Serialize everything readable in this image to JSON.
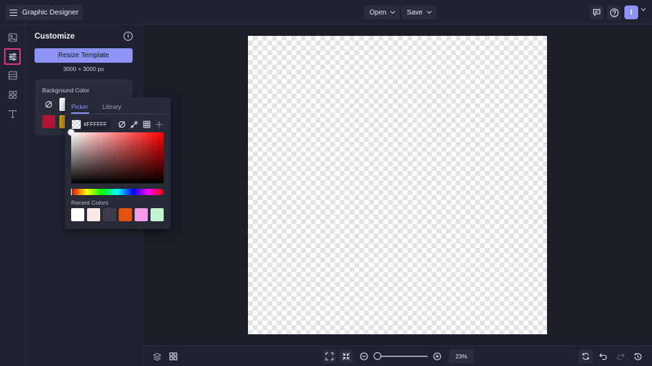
{
  "header": {
    "app_title": "Graphic Designer",
    "open_label": "Open",
    "save_label": "Save",
    "user_initial": "I"
  },
  "panel": {
    "title": "Customize",
    "resize_label": "Resize Template",
    "size_text": "3000 × 3000 px",
    "bg_label": "Background Color",
    "bg_swatches": [
      "#ffffff",
      "#b41234",
      "#d4a017"
    ]
  },
  "picker": {
    "tabs": [
      "Picker",
      "Library"
    ],
    "active_tab": "Picker",
    "hex_value": "#FFFFFF",
    "recent_label": "Recent Colors",
    "recent_colors": [
      "#ffffff",
      "#fde8e4",
      "#3e3c4a",
      "#e4520e",
      "#f29ae9",
      "#c4f5d3"
    ]
  },
  "canvas": {
    "zoom": "23%"
  },
  "colors": {
    "accent": "#8c93f4",
    "active_rail_border": "#e8357a",
    "panel_bg": "#20232f",
    "workspace_bg": "#1b1e29"
  }
}
